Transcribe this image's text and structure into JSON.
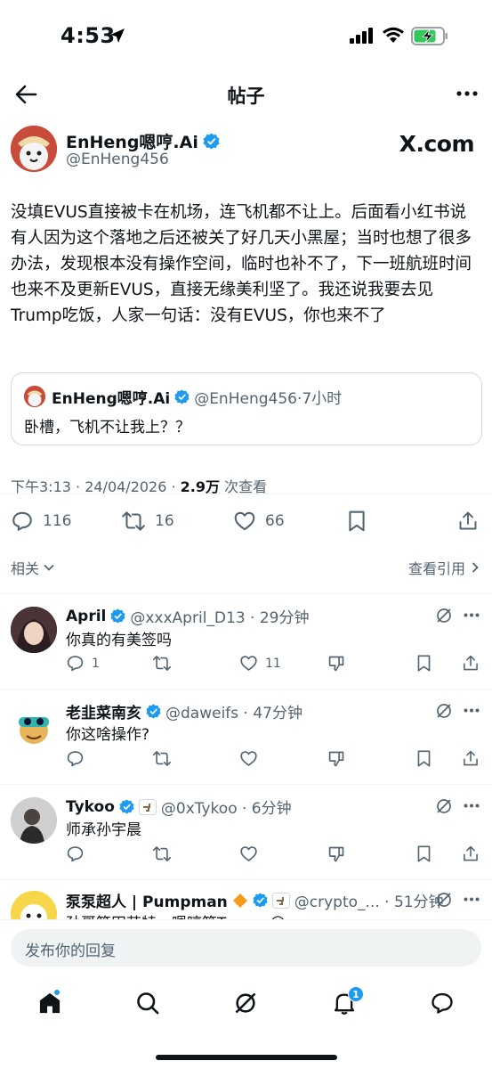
{
  "status_bar": {
    "time": "4:53"
  },
  "nav": {
    "title": "帖子"
  },
  "post": {
    "author_name": "EnHeng嗯哼.Ai",
    "author_handle": "@EnHeng456",
    "brand": "X.com",
    "text": "没填EVUS直接被卡在机场，连飞机都不让上。后面看小红书说有人因为这个落地之后还被关了好几天小黑屋；当时也想了很多办法，发现根本没有操作空间，临时也补不了，下一班航班时间也来不及更新EVUS，直接无缘美利坚了。我还说我要去见Trump吃饭，人家一句话：没有EVUS，你也来不了",
    "quote": {
      "name": "EnHeng嗯哼.Ai",
      "handle_time": "@EnHeng456·7小时",
      "text": "卧槽，飞机不让我上？？"
    },
    "timestamp": "下午3:13 · 24/04/2026 · ",
    "views": "2.9万",
    "views_label": " 次查看",
    "replies": "116",
    "reposts": "16",
    "likes": "66"
  },
  "related_label": "相关",
  "view_quotes_label": "查看引用",
  "replies": [
    {
      "name": "April",
      "handle_time": "@xxxApril_D13 · 29分钟",
      "text": "你真的有美签吗",
      "reply_count": "1",
      "like_count": "11",
      "avatar_color": "#3a2b2e"
    },
    {
      "name": "老韭菜南亥",
      "handle_time": "@daweifs · 47分钟",
      "text": "你这啥操作?",
      "reply_count": "",
      "like_count": "",
      "avatar_color": "#f3f3f3"
    },
    {
      "name": "Tykoo",
      "handle_time": "@0xTykoo · 6分钟",
      "text": "师承孙宇晨",
      "reply_count": "",
      "like_count": "",
      "avatar_color": "#d9d9d9"
    },
    {
      "name": "泵泵超人 | Pumpman",
      "handle_time": "@crypto_... · 51分钟",
      "text": "孙哥筷田芸特，嗯哼筷Trump 😂",
      "reply_count": "",
      "like_count": "",
      "avatar_color": "#f5d34a"
    }
  ],
  "composer": {
    "placeholder": "发布你的回复"
  },
  "tabbar": {
    "notifications_badge": "1"
  },
  "colors": {
    "accent": "#1d9bf0",
    "verified": "#1d9bf0",
    "text": "#0f1419",
    "secondary": "#536471"
  }
}
